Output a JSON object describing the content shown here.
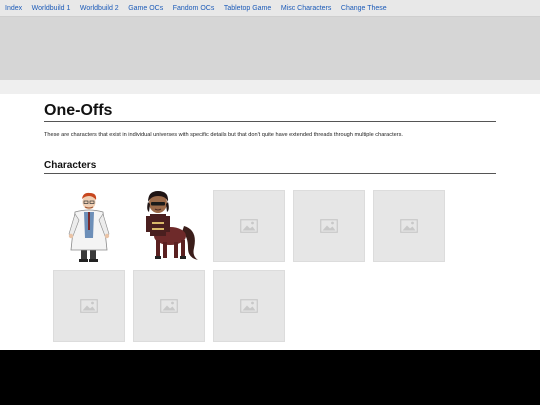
{
  "nav": {
    "items": [
      "Index",
      "Worldbuild 1",
      "Worldbuild 2",
      "Game OCs",
      "Fandom OCs",
      "Tabletop Game",
      "Misc Characters",
      "Change These"
    ]
  },
  "page": {
    "title": "One-Offs",
    "description": "These are characters that exist in individual universes with specific details but that don't quite have extended threads through multiple characters.",
    "section_title": "Characters"
  },
  "gallery": {
    "tiles": [
      {
        "kind": "character",
        "icon": "doctor-character-portrait"
      },
      {
        "kind": "character",
        "icon": "centaur-character-portrait"
      },
      {
        "kind": "placeholder",
        "icon": "image-placeholder-icon"
      },
      {
        "kind": "placeholder",
        "icon": "image-placeholder-icon"
      },
      {
        "kind": "placeholder",
        "icon": "image-placeholder-icon"
      },
      {
        "kind": "placeholder",
        "icon": "image-placeholder-icon"
      },
      {
        "kind": "placeholder",
        "icon": "image-placeholder-icon"
      },
      {
        "kind": "placeholder",
        "icon": "image-placeholder-icon"
      }
    ]
  },
  "colors": {
    "nav_bg": "#e8e8e8",
    "link": "#1c5bb8",
    "banner": "#d6d6d6",
    "placeholder_tile": "#e6e6e6",
    "footer": "#000000"
  }
}
